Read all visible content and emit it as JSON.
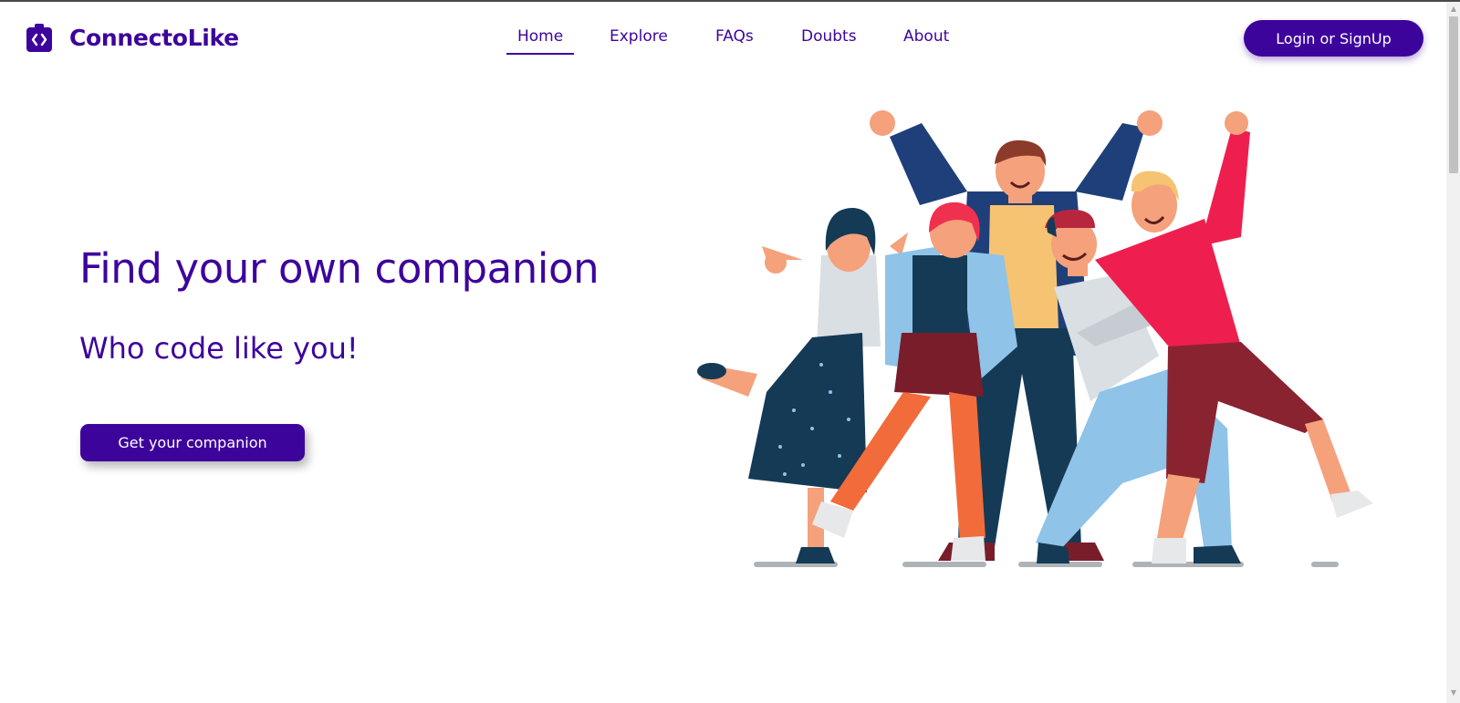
{
  "brand": {
    "name": "ConnectoLike",
    "icon": "code-badge-icon",
    "color": "#3d049c"
  },
  "nav": {
    "items": [
      {
        "label": "Home",
        "active": true
      },
      {
        "label": "Explore",
        "active": false
      },
      {
        "label": "FAQs",
        "active": false
      },
      {
        "label": "Doubts",
        "active": false
      },
      {
        "label": "About",
        "active": false
      }
    ]
  },
  "header": {
    "login_label": "Login or SignUp"
  },
  "hero": {
    "title": "Find your own companion",
    "subtitle": "Who code like you!",
    "cta_label": "Get your companion",
    "illustration": "group-of-friends-cheering-illustration"
  },
  "colors": {
    "accent": "#3d049c",
    "background": "#ffffff"
  }
}
